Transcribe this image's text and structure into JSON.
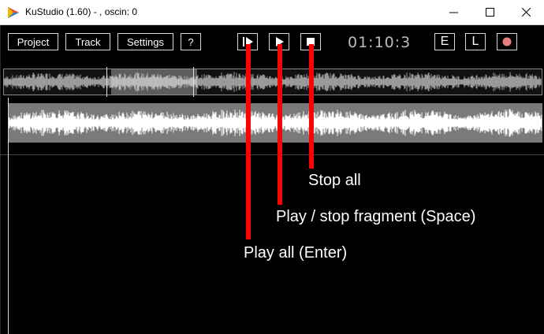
{
  "window": {
    "title": "KuStudio (1.60) - , oscin: 0"
  },
  "toolbar": {
    "project_label": "Project",
    "track_label": "Track",
    "settings_label": "Settings",
    "help_label": "?",
    "time": "01:10:3",
    "e_label": "E",
    "l_label": "L"
  },
  "icons": {
    "play_all": "play-bar-icon",
    "play_fragment": "play-icon",
    "stop_all": "stop-icon",
    "record": "record-icon"
  },
  "annotations": {
    "stop_all": "Stop all",
    "play_fragment": "Play / stop fragment (Space)",
    "play_all": "Play all (Enter)"
  },
  "colors": {
    "annotation_line": "#ff0000",
    "record_dot": "#e88080"
  }
}
